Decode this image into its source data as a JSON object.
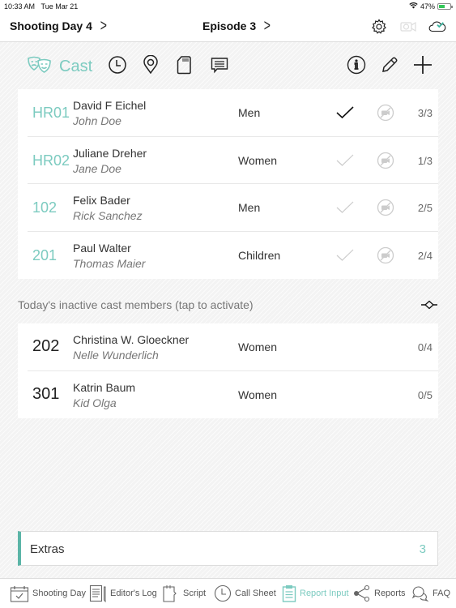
{
  "status_bar": {
    "time": "10:33 AM",
    "date": "Tue Mar 21",
    "battery_percent": "47%",
    "battery_level": 0.47
  },
  "nav": {
    "shooting_day": "Shooting Day 4",
    "episode": "Episode 3",
    "icons": [
      "gear-icon",
      "camera-sync-icon",
      "cloud-check-icon"
    ]
  },
  "toolbar": {
    "active_tab": "Cast",
    "icons": [
      "masks-icon",
      "clock-icon",
      "location-pin-icon",
      "sd-card-icon",
      "message-icon",
      "info-icon",
      "pencil-icon",
      "plus-icon"
    ]
  },
  "active_cast": [
    {
      "code": "HR01",
      "actor": "David F Eichel",
      "role": "John Doe",
      "group": "Men",
      "checked": true,
      "count": "3/3"
    },
    {
      "code": "HR02",
      "actor": "Juliane Dreher",
      "role": "Jane Doe",
      "group": "Women",
      "checked": false,
      "count": "1/3"
    },
    {
      "code": "102",
      "actor": "Felix Bader",
      "role": "Rick Sanchez",
      "group": "Men",
      "checked": false,
      "count": "2/5"
    },
    {
      "code": "201",
      "actor": "Paul Walter",
      "role": "Thomas Maier",
      "group": "Children",
      "checked": false,
      "count": "2/4"
    }
  ],
  "inactive_section": {
    "label": "Today's inactive cast members (tap to activate)"
  },
  "inactive_cast": [
    {
      "code": "202",
      "actor": "Christina W. Gloeckner",
      "role": "Nelle Wunderlich",
      "group": "Women",
      "count": "0/4"
    },
    {
      "code": "301",
      "actor": "Katrin Baum",
      "role": "Kid Olga",
      "group": "Women",
      "count": "0/5"
    }
  ],
  "extras": {
    "label": "Extras",
    "value": "3"
  },
  "tabbar": [
    {
      "label": "Shooting Day",
      "icon": "calendar-check-icon",
      "active": false
    },
    {
      "label": "Editor's Log",
      "icon": "notepad-icon",
      "active": false
    },
    {
      "label": "Script",
      "icon": "script-icon",
      "active": false
    },
    {
      "label": "Call Sheet",
      "icon": "clock-icon",
      "active": false
    },
    {
      "label": "Report Input",
      "icon": "clipboard-icon",
      "active": true
    },
    {
      "label": "Reports",
      "icon": "share-icon",
      "active": false
    },
    {
      "label": "FAQ",
      "icon": "chat-bubbles-icon",
      "active": false
    }
  ],
  "colors": {
    "accent": "#7ccbc0",
    "extras_bar": "#5bb5a7",
    "cloud_check": "#3db39e"
  }
}
